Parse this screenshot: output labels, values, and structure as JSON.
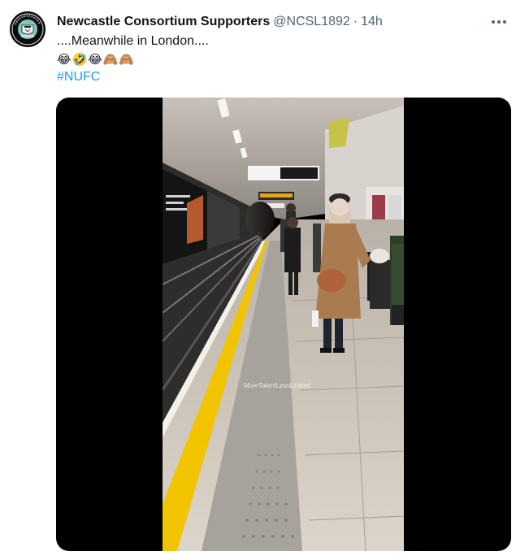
{
  "author": {
    "name": "Newcastle Consortium Supporters",
    "handle": "@NCSL1892",
    "separator": "·",
    "time": "14h"
  },
  "post": {
    "text": "....Meanwhile in London....",
    "emojis": "😂🤣😂🙈🙈",
    "hashtag": "#NUFC"
  },
  "media": {
    "watermark": "MoreTalentLessLimited"
  },
  "icons": {
    "more": "more-horizontal-icon"
  },
  "colors": {
    "link": "#1d9bf0",
    "secondary_text": "#536471",
    "platform_line": "#f2c400"
  }
}
